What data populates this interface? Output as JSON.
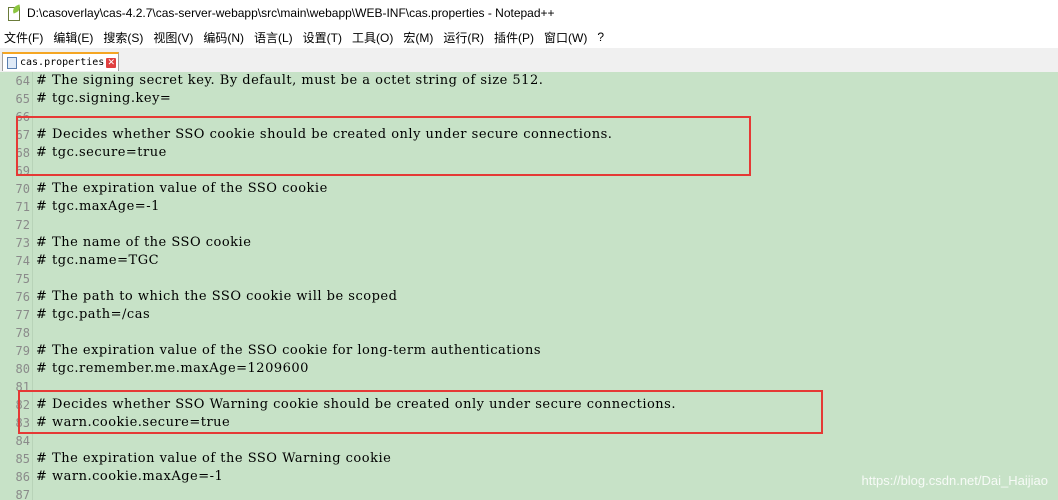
{
  "window": {
    "title": "D:\\casoverlay\\cas-4.2.7\\cas-server-webapp\\src\\main\\webapp\\WEB-INF\\cas.properties - Notepad++"
  },
  "menu": [
    {
      "label": "文件(F)"
    },
    {
      "label": "编辑(E)"
    },
    {
      "label": "搜索(S)"
    },
    {
      "label": "视图(V)"
    },
    {
      "label": "编码(N)"
    },
    {
      "label": "语言(L)"
    },
    {
      "label": "设置(T)"
    },
    {
      "label": "工具(O)"
    },
    {
      "label": "宏(M)"
    },
    {
      "label": "运行(R)"
    },
    {
      "label": "插件(P)"
    },
    {
      "label": "窗口(W)"
    },
    {
      "label": "?"
    }
  ],
  "tab": {
    "label": "cas.properties"
  },
  "lines": [
    {
      "num": "64",
      "text": "# The signing secret key. By default, must be a octet string of size 512."
    },
    {
      "num": "65",
      "text": "# tgc.signing.key="
    },
    {
      "num": "66",
      "text": ""
    },
    {
      "num": "67",
      "text": "# Decides whether SSO cookie should be created only under secure connections."
    },
    {
      "num": "68",
      "text": "# tgc.secure=true"
    },
    {
      "num": "69",
      "text": ""
    },
    {
      "num": "70",
      "text": "# The expiration value of the SSO cookie"
    },
    {
      "num": "71",
      "text": "# tgc.maxAge=-1"
    },
    {
      "num": "72",
      "text": ""
    },
    {
      "num": "73",
      "text": "# The name of the SSO cookie"
    },
    {
      "num": "74",
      "text": "# tgc.name=TGC"
    },
    {
      "num": "75",
      "text": ""
    },
    {
      "num": "76",
      "text": "# The path to which the SSO cookie will be scoped"
    },
    {
      "num": "77",
      "text": "# tgc.path=/cas"
    },
    {
      "num": "78",
      "text": ""
    },
    {
      "num": "79",
      "text": "# The expiration value of the SSO cookie for long-term authentications"
    },
    {
      "num": "80",
      "text": "# tgc.remember.me.maxAge=1209600"
    },
    {
      "num": "81",
      "text": ""
    },
    {
      "num": "82",
      "text": "# Decides whether SSO Warning cookie should be created only under secure connections."
    },
    {
      "num": "83",
      "text": "# warn.cookie.secure=true"
    },
    {
      "num": "84",
      "text": ""
    },
    {
      "num": "85",
      "text": "# The expiration value of the SSO Warning cookie"
    },
    {
      "num": "86",
      "text": "# warn.cookie.maxAge=-1"
    },
    {
      "num": "87",
      "text": ""
    }
  ],
  "watermark": "https://blog.csdn.net/Dai_Haijiao",
  "colors": {
    "editor_bg": "#c7e2c7",
    "highlight_border": "#e53935"
  }
}
